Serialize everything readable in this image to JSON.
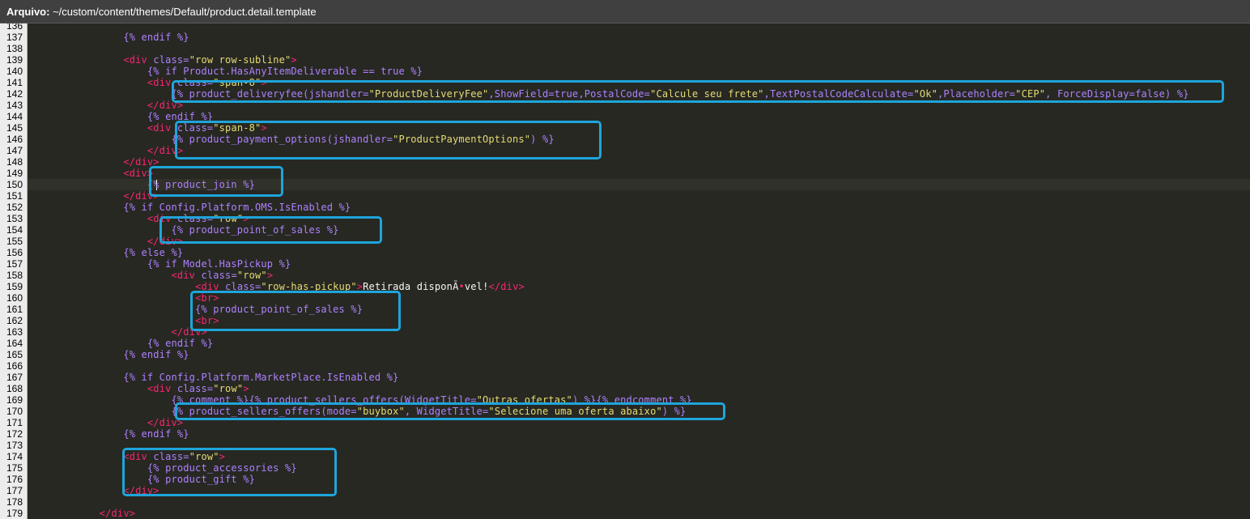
{
  "title_bar": {
    "label": "Arquivo:",
    "path": " ~/custom/content/themes/Default/product.detail.template"
  },
  "editor": {
    "first_line": 136,
    "current_line": 150,
    "lines": [
      {
        "n": "136",
        "t": []
      },
      {
        "n": "137",
        "t": [
          [
            "p",
            "                {% endif %}"
          ]
        ]
      },
      {
        "n": "138",
        "t": []
      },
      {
        "n": "139",
        "t": [
          [
            "p",
            "                "
          ],
          [
            "tag",
            "<div "
          ],
          [
            "p",
            "class="
          ],
          [
            "str",
            "\"row row-subline\""
          ],
          [
            "tag",
            ">"
          ]
        ]
      },
      {
        "n": "140",
        "t": [
          [
            "p",
            "                    {% if Product.HasAnyItemDeliverable == true %}"
          ]
        ]
      },
      {
        "n": "141",
        "t": [
          [
            "p",
            "                    "
          ],
          [
            "tag",
            "<div "
          ],
          [
            "p",
            "class="
          ],
          [
            "str",
            "\"span-8\""
          ],
          [
            "tag",
            ">"
          ]
        ]
      },
      {
        "n": "142",
        "t": [
          [
            "p",
            "                        {% product_deliveryfee(jshandler="
          ],
          [
            "str",
            "\"ProductDeliveryFee\""
          ],
          [
            "p",
            ",ShowField=true,PostalCode="
          ],
          [
            "str",
            "\"Calcule seu frete\""
          ],
          [
            "p",
            ",TextPostalCodeCalculate="
          ],
          [
            "str",
            "\"Ok\""
          ],
          [
            "p",
            ",Placeholder="
          ],
          [
            "str",
            "\"CEP\""
          ],
          [
            "p",
            ", ForceDisplay=false) %}"
          ]
        ]
      },
      {
        "n": "143",
        "t": [
          [
            "p",
            "                    "
          ],
          [
            "tag",
            "</div>"
          ]
        ]
      },
      {
        "n": "144",
        "t": [
          [
            "p",
            "                    {% endif %}"
          ]
        ]
      },
      {
        "n": "145",
        "t": [
          [
            "p",
            "                    "
          ],
          [
            "tag",
            "<div "
          ],
          [
            "p",
            "class="
          ],
          [
            "str",
            "\"span-8\""
          ],
          [
            "tag",
            ">"
          ]
        ]
      },
      {
        "n": "146",
        "t": [
          [
            "p",
            "                        {% product_payment_options(jshandler="
          ],
          [
            "str",
            "\"ProductPaymentOptions\""
          ],
          [
            "p",
            ") %}"
          ]
        ]
      },
      {
        "n": "147",
        "t": [
          [
            "p",
            "                    "
          ],
          [
            "tag",
            "</div>"
          ]
        ]
      },
      {
        "n": "148",
        "t": [
          [
            "p",
            "                "
          ],
          [
            "tag",
            "</div>"
          ]
        ]
      },
      {
        "n": "149",
        "t": [
          [
            "p",
            "                "
          ],
          [
            "tag",
            "<div>"
          ]
        ]
      },
      {
        "n": "150",
        "t": [
          [
            "p",
            "                    {% product_join %}"
          ]
        ]
      },
      {
        "n": "151",
        "t": [
          [
            "p",
            "                "
          ],
          [
            "tag",
            "</div>"
          ]
        ]
      },
      {
        "n": "152",
        "t": [
          [
            "p",
            "                {% if Config.Platform.OMS.IsEnabled %}"
          ]
        ]
      },
      {
        "n": "153",
        "t": [
          [
            "p",
            "                    "
          ],
          [
            "tag",
            "<div "
          ],
          [
            "p",
            "class="
          ],
          [
            "str",
            "\"row\""
          ],
          [
            "tag",
            ">"
          ]
        ]
      },
      {
        "n": "154",
        "t": [
          [
            "p",
            "                        {% product_point_of_sales %}"
          ]
        ]
      },
      {
        "n": "155",
        "t": [
          [
            "p",
            "                    "
          ],
          [
            "tag",
            "</div>"
          ]
        ]
      },
      {
        "n": "156",
        "t": [
          [
            "p",
            "                {% else %}"
          ]
        ]
      },
      {
        "n": "157",
        "t": [
          [
            "p",
            "                    {% if Model.HasPickup %}"
          ]
        ]
      },
      {
        "n": "158",
        "t": [
          [
            "p",
            "                        "
          ],
          [
            "tag",
            "<div "
          ],
          [
            "p",
            "class="
          ],
          [
            "str",
            "\"row\""
          ],
          [
            "tag",
            ">"
          ]
        ]
      },
      {
        "n": "159",
        "t": [
          [
            "p",
            "                            "
          ],
          [
            "tag",
            "<div "
          ],
          [
            "p",
            "class="
          ],
          [
            "str",
            "\"row-has-pickup\""
          ],
          [
            "tag",
            ">"
          ],
          [
            "txt",
            "Retirada disponÃ"
          ],
          [
            "tag",
            "•"
          ],
          [
            "txt",
            "vel!"
          ],
          [
            "tag",
            "</div>"
          ]
        ]
      },
      {
        "n": "160",
        "t": [
          [
            "p",
            "                            "
          ],
          [
            "tag",
            "<br>"
          ]
        ]
      },
      {
        "n": "161",
        "t": [
          [
            "p",
            "                            {% product_point_of_sales %}"
          ]
        ]
      },
      {
        "n": "162",
        "t": [
          [
            "p",
            "                            "
          ],
          [
            "tag",
            "<br>"
          ]
        ]
      },
      {
        "n": "163",
        "t": [
          [
            "p",
            "                        "
          ],
          [
            "tag",
            "</div>"
          ]
        ]
      },
      {
        "n": "164",
        "t": [
          [
            "p",
            "                    {% endif %}"
          ]
        ]
      },
      {
        "n": "165",
        "t": [
          [
            "p",
            "                {% endif %}"
          ]
        ]
      },
      {
        "n": "166",
        "t": []
      },
      {
        "n": "167",
        "t": [
          [
            "p",
            "                {% if Config.Platform.MarketPlace.IsEnabled %}"
          ]
        ]
      },
      {
        "n": "168",
        "t": [
          [
            "p",
            "                    "
          ],
          [
            "tag",
            "<div "
          ],
          [
            "p",
            "class="
          ],
          [
            "str",
            "\"row\""
          ],
          [
            "tag",
            ">"
          ]
        ]
      },
      {
        "n": "169",
        "t": [
          [
            "p",
            "                        {% comment %}{% product_sellers_offers(WidgetTitle="
          ],
          [
            "str",
            "\"Outras ofertas\""
          ],
          [
            "p",
            ") %}{% endcomment %}"
          ]
        ]
      },
      {
        "n": "170",
        "t": [
          [
            "p",
            "                        {% product_sellers_offers(mode="
          ],
          [
            "str",
            "\"buybox\""
          ],
          [
            "p",
            ", WidgetTitle="
          ],
          [
            "str",
            "\"Selecione uma oferta abaixo\""
          ],
          [
            "p",
            ") %}"
          ]
        ]
      },
      {
        "n": "171",
        "t": [
          [
            "p",
            "                    "
          ],
          [
            "tag",
            "</div>"
          ]
        ]
      },
      {
        "n": "172",
        "t": [
          [
            "p",
            "                {% endif %}"
          ]
        ]
      },
      {
        "n": "173",
        "t": []
      },
      {
        "n": "174",
        "t": [
          [
            "p",
            "                "
          ],
          [
            "tag",
            "<div "
          ],
          [
            "p",
            "class="
          ],
          [
            "str",
            "\"row\""
          ],
          [
            "tag",
            ">"
          ]
        ]
      },
      {
        "n": "175",
        "t": [
          [
            "p",
            "                    {% product_accessories %}"
          ]
        ]
      },
      {
        "n": "176",
        "t": [
          [
            "p",
            "                    {% product_gift %}"
          ]
        ]
      },
      {
        "n": "177",
        "t": [
          [
            "p",
            "                "
          ],
          [
            "tag",
            "</div>"
          ]
        ]
      },
      {
        "n": "178",
        "t": []
      },
      {
        "n": "179",
        "t": [
          [
            "p",
            "            "
          ],
          [
            "tag",
            "</div>"
          ]
        ]
      }
    ]
  },
  "colors": {
    "background": "#272822",
    "template_directive": "#ae81ff",
    "html_tag": "#f92672",
    "string": "#e6db74",
    "plain_text": "#f8f8f2",
    "highlight_box": "#1ea5db",
    "gutter": "#ececec"
  },
  "annotations": [
    {
      "name": "highlight-deliveryfee",
      "label": "product_deliveryfee"
    },
    {
      "name": "highlight-payment-options",
      "label": "product_payment_options"
    },
    {
      "name": "highlight-product-join",
      "label": "product_join"
    },
    {
      "name": "highlight-point-of-sales-oms",
      "label": "product_point_of_sales (OMS)"
    },
    {
      "name": "highlight-point-of-sales-pickup",
      "label": "product_point_of_sales (pickup)"
    },
    {
      "name": "highlight-sellers-offers",
      "label": "product_sellers_offers"
    },
    {
      "name": "highlight-accessories-gift",
      "label": "product_accessories / product_gift"
    }
  ]
}
